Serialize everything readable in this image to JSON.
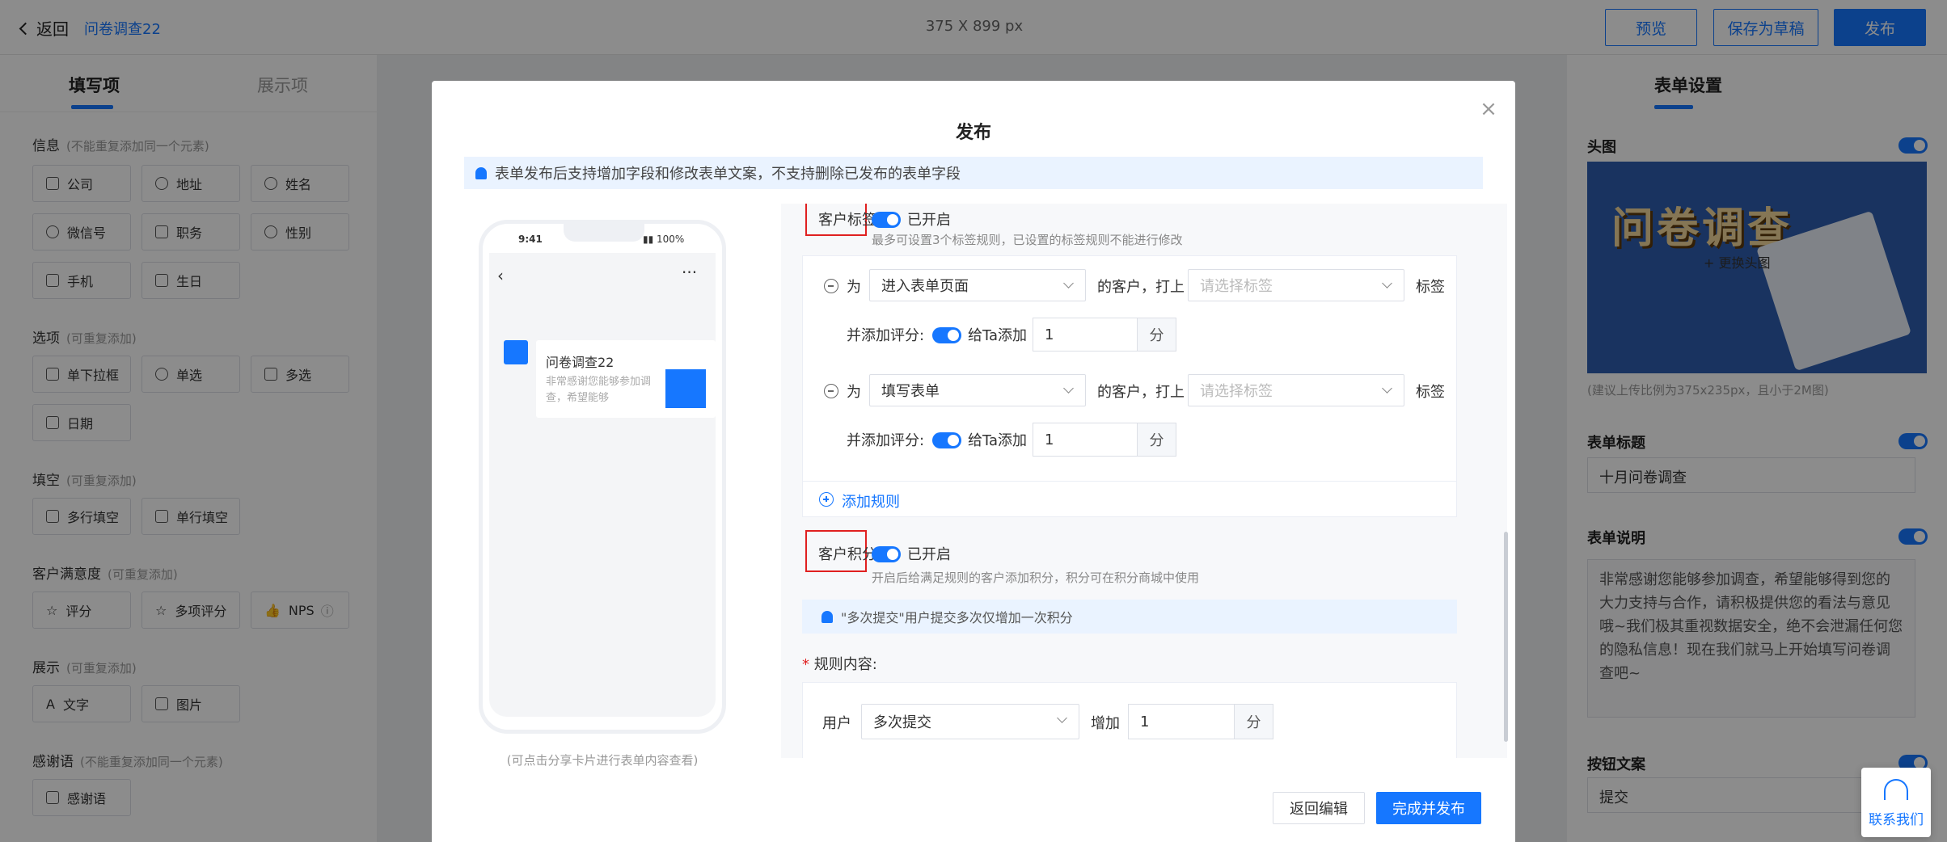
{
  "header": {
    "back_label": "返回",
    "form_name": "问卷调查22",
    "canvas_size": "375 X 899 px",
    "preview_label": "预览",
    "save_draft_label": "保存为草稿",
    "publish_label": "发布"
  },
  "left_panel": {
    "tabs": [
      "填写项",
      "展示项"
    ],
    "sections": [
      {
        "title": "信息",
        "hint": "(不能重复添加同一个元素)",
        "items": [
          "公司",
          "地址",
          "姓名",
          "微信号",
          "职务",
          "性别",
          "手机",
          "生日"
        ]
      },
      {
        "title": "选项",
        "hint": "(可重复添加)",
        "items": [
          "单下拉框",
          "单选",
          "多选",
          "日期"
        ]
      },
      {
        "title": "填空",
        "hint": "(可重复添加)",
        "items": [
          "多行填空",
          "单行填空"
        ]
      },
      {
        "title": "客户满意度",
        "hint": "(可重复添加)",
        "items": [
          "评分",
          "多项评分",
          "NPS"
        ]
      },
      {
        "title": "展示",
        "hint": "(可重复添加)",
        "items": [
          "文字",
          "图片"
        ]
      },
      {
        "title": "感谢语",
        "hint": "(不能重复添加同一个元素)",
        "items": [
          "感谢语"
        ]
      }
    ]
  },
  "right_panel": {
    "title": "表单设置",
    "header_image_label": "头图",
    "banner_text": "问卷调查",
    "change_image_label": "+ 更换头图",
    "image_hint": "(建议上传比例为375x235px，且小于2M图)",
    "form_title_label": "表单标题",
    "form_title_value": "十月问卷调查",
    "form_desc_label": "表单说明",
    "form_desc_value": "非常感谢您能够参加调查，希望能够得到您的大力支持与合作，请积极提供您的看法与意见哦~我们极其重视数据安全，绝不会泄漏任何您的隐私信息！现在我们就马上开始填写问卷调查吧~",
    "button_text_label": "按钮文案",
    "button_text_value": "提交",
    "accent_color": "#1677ff"
  },
  "modal": {
    "title": "发布",
    "notice": "表单发布后支持增加字段和修改表单文案，不支持删除已发布的表单字段",
    "phone": {
      "time": "9:41",
      "battery": "100%",
      "card_title": "问卷调查22",
      "card_desc": "非常感谢您能够参加调查，希望能够",
      "caption": "(可点击分享卡片进行表单内容查看)"
    },
    "tag_section": {
      "label": "客户标签:",
      "status": "已开启",
      "hint": "最多可设置3个标签规则，已设置的标签规则不能进行修改",
      "rules": [
        {
          "for": "为",
          "trigger": "进入表单页面",
          "mid": "的客户，打上",
          "tag_placeholder": "请选择标签",
          "tag_suffix": "标签",
          "score_label": "并添加评分:",
          "give_label": "给Ta添加",
          "score": "1",
          "unit": "分"
        },
        {
          "for": "为",
          "trigger": "填写表单",
          "mid": "的客户，打上",
          "tag_placeholder": "请选择标签",
          "tag_suffix": "标签",
          "score_label": "并添加评分:",
          "give_label": "给Ta添加",
          "score": "1",
          "unit": "分"
        }
      ],
      "add_rule_label": "添加规则"
    },
    "points_section": {
      "label": "客户积分:",
      "status": "已开启",
      "hint": "开启后给满足规则的客户添加积分，积分可在积分商城中使用",
      "notice": "\"多次提交\"用户提交多次仅增加一次积分",
      "rule_content_label": "规则内容:",
      "required_mark": "*",
      "user_label": "用户",
      "action": "多次提交",
      "increase_label": "增加",
      "points": "1",
      "unit": "分"
    },
    "back_edit_label": "返回编辑",
    "finish_label": "完成并发布"
  },
  "contact_label": "联系我们"
}
